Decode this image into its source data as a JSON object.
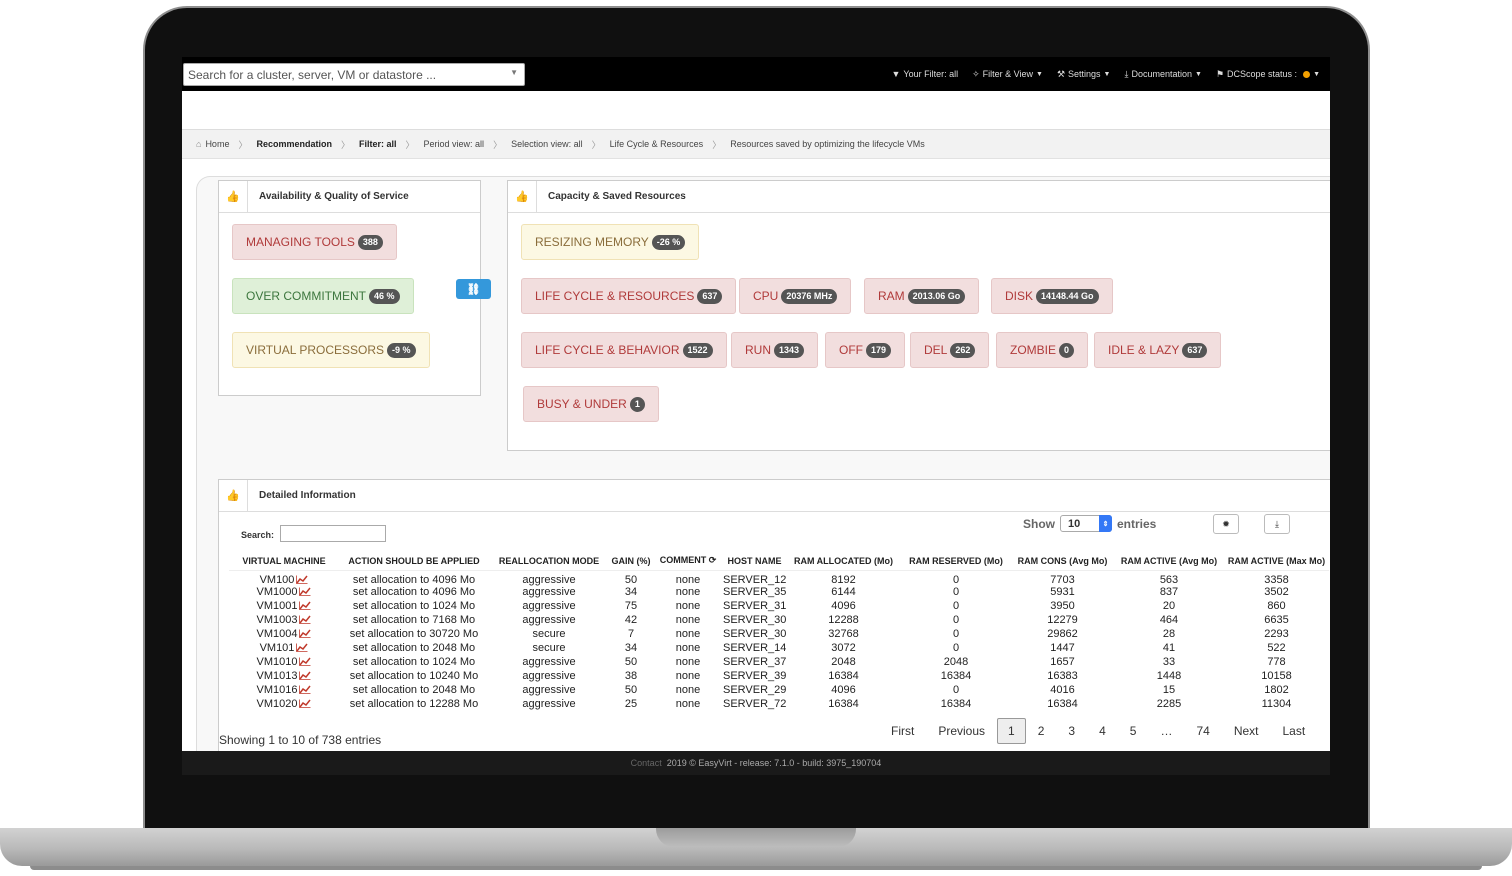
{
  "topbar": {
    "search_placeholder": "Search for a cluster, server, VM or datastore ...",
    "menu": [
      {
        "label": "Your Filter: all",
        "icon": "filter-icon",
        "caret": false
      },
      {
        "label": "Filter & View",
        "icon": "crosshair-icon",
        "caret": true
      },
      {
        "label": "Settings",
        "icon": "wrench-icon",
        "caret": true
      },
      {
        "label": "Documentation",
        "icon": "download-icon",
        "caret": true
      },
      {
        "label": "DCScope status :",
        "icon": "flag-icon",
        "caret": true
      }
    ],
    "status_color": "#f3a000"
  },
  "breadcrumb": [
    "Home",
    "Recommendation",
    "Filter: all",
    "Period view: all",
    "Selection view: all",
    "Life Cycle & Resources",
    "Resources saved by optimizing the lifecycle VMs"
  ],
  "availability": {
    "title": "Availability & Quality of Service",
    "buttons": [
      {
        "label": "MANAGING TOOLS",
        "badge": "388"
      },
      {
        "label": "OVER COMMITMENT",
        "badge": "46 %"
      },
      {
        "label": "VIRTUAL PROCESSORS",
        "badge": "-9 %"
      }
    ]
  },
  "capacity": {
    "title": "Capacity & Saved Resources",
    "resizing": {
      "label": "RESIZING MEMORY",
      "badge": "-26 %"
    },
    "lifecycle_resources": [
      {
        "label": "LIFE CYCLE & RESOURCES",
        "badge": "637"
      },
      {
        "label": "CPU",
        "badge": "20376 MHz"
      },
      {
        "label": "RAM",
        "badge": "2013.06 Go"
      },
      {
        "label": "DISK",
        "badge": "14148.44 Go"
      }
    ],
    "lifecycle_behavior": [
      {
        "label": "LIFE CYCLE & BEHAVIOR",
        "badge": "1522"
      },
      {
        "label": "RUN",
        "badge": "1343"
      },
      {
        "label": "OFF",
        "badge": "179"
      },
      {
        "label": "DEL",
        "badge": "262"
      },
      {
        "label": "ZOMBIE",
        "badge": "0"
      },
      {
        "label": "IDLE & LAZY",
        "badge": "637"
      }
    ],
    "busy": {
      "label": "BUSY & UNDER",
      "badge": "1"
    }
  },
  "detail": {
    "title": "Detailed Information",
    "search_label": "Search:",
    "show_label": "Show",
    "show_value": "10",
    "entries_label": "entries",
    "columns": [
      "VIRTUAL MACHINE",
      "ACTION SHOULD BE APPLIED",
      "REALLOCATION MODE",
      "GAIN (%)",
      "COMMENT",
      "HOST NAME",
      "RAM ALLOCATED (Mo)",
      "RAM RESERVED (Mo)",
      "RAM CONS (Avg Mo)",
      "RAM ACTIVE (Avg Mo)",
      "RAM ACTIVE (Max Mo)"
    ],
    "rows": [
      [
        "VM100",
        "set allocation to 4096 Mo",
        "aggressive",
        "50",
        "none",
        "SERVER_12",
        "8192",
        "0",
        "7703",
        "563",
        "3358"
      ],
      [
        "VM1000",
        "set allocation to 4096 Mo",
        "aggressive",
        "34",
        "none",
        "SERVER_35",
        "6144",
        "0",
        "5931",
        "837",
        "3502"
      ],
      [
        "VM1001",
        "set allocation to 1024 Mo",
        "aggressive",
        "75",
        "none",
        "SERVER_31",
        "4096",
        "0",
        "3950",
        "20",
        "860"
      ],
      [
        "VM1003",
        "set allocation to 7168 Mo",
        "aggressive",
        "42",
        "none",
        "SERVER_30",
        "12288",
        "0",
        "12279",
        "464",
        "6635"
      ],
      [
        "VM1004",
        "set allocation to 30720 Mo",
        "secure",
        "7",
        "none",
        "SERVER_30",
        "32768",
        "0",
        "29862",
        "28",
        "2293"
      ],
      [
        "VM101",
        "set allocation to 2048 Mo",
        "secure",
        "34",
        "none",
        "SERVER_14",
        "3072",
        "0",
        "1447",
        "41",
        "522"
      ],
      [
        "VM1010",
        "set allocation to 1024 Mo",
        "aggressive",
        "50",
        "none",
        "SERVER_37",
        "2048",
        "2048",
        "1657",
        "33",
        "778"
      ],
      [
        "VM1013",
        "set allocation to 10240 Mo",
        "aggressive",
        "38",
        "none",
        "SERVER_39",
        "16384",
        "16384",
        "16383",
        "1448",
        "10158"
      ],
      [
        "VM1016",
        "set allocation to 2048 Mo",
        "aggressive",
        "50",
        "none",
        "SERVER_29",
        "4096",
        "0",
        "4016",
        "15",
        "1802"
      ],
      [
        "VM1020",
        "set allocation to 12288 Mo",
        "aggressive",
        "25",
        "none",
        "SERVER_72",
        "16384",
        "16384",
        "16384",
        "2285",
        "11304"
      ]
    ],
    "showing": "Showing 1 to 10 of 738 entries",
    "pagination": [
      "First",
      "Previous",
      "1",
      "2",
      "3",
      "4",
      "5",
      "…",
      "74",
      "Next",
      "Last"
    ],
    "current_page": "1"
  },
  "footer": {
    "contact": "Contact",
    "text": "2019 © EasyVirt - release: 7.1.0 - build: 3975_190704"
  }
}
